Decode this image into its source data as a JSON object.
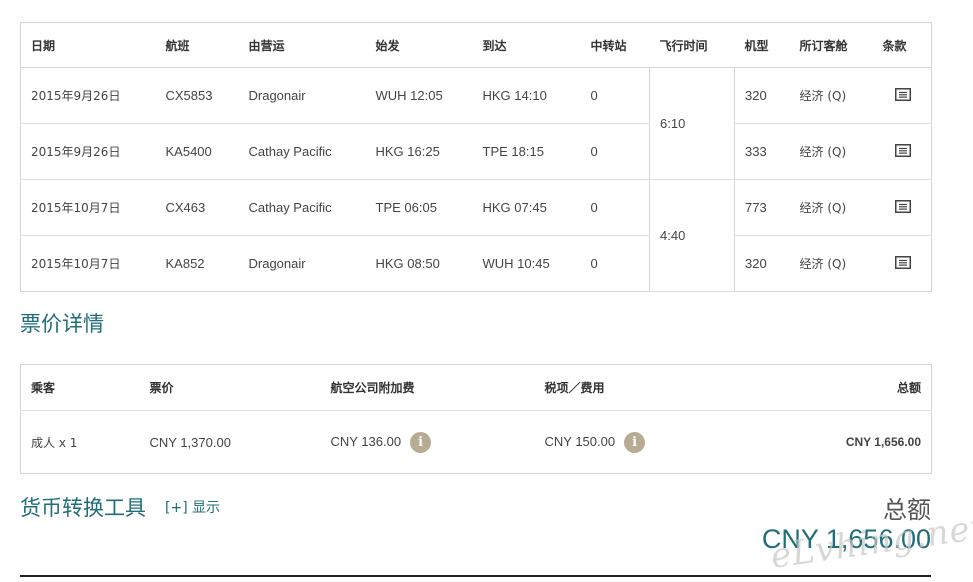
{
  "flights": {
    "headers": {
      "date": "日期",
      "flight": "航班",
      "operator": "由营运",
      "depart": "始发",
      "arrive": "到达",
      "stops": "中转站",
      "duration": "飞行时间",
      "aircraft": "机型",
      "cabin": "所订客舱",
      "terms": "条款"
    },
    "rows": [
      {
        "date": "2015年9月26日",
        "flight": "CX5853",
        "operator": "Dragonair",
        "depart": "WUH 12:05",
        "arrive": "HKG 14:10",
        "stops": "0",
        "aircraft": "320",
        "cabin": "经济 (Q)"
      },
      {
        "date": "2015年9月26日",
        "flight": "KA5400",
        "operator": "Cathay Pacific",
        "depart": "HKG 16:25",
        "arrive": "TPE 18:15",
        "stops": "0",
        "aircraft": "333",
        "cabin": "经济 (Q)"
      },
      {
        "date": "2015年10月7日",
        "flight": "CX463",
        "operator": "Cathay Pacific",
        "depart": "TPE 06:05",
        "arrive": "HKG 07:45",
        "stops": "0",
        "aircraft": "773",
        "cabin": "经济 (Q)"
      },
      {
        "date": "2015年10月7日",
        "flight": "KA852",
        "operator": "Dragonair",
        "depart": "HKG 08:50",
        "arrive": "WUH 10:45",
        "stops": "0",
        "aircraft": "320",
        "cabin": "经济 (Q)"
      }
    ],
    "durations": [
      "6:10",
      "4:40"
    ]
  },
  "fare_section": {
    "title": "票价详情",
    "headers": {
      "passenger": "乘客",
      "fare": "票价",
      "surcharge": "航空公司附加费",
      "taxes": "税项／费用",
      "total": "总额"
    },
    "row": {
      "passenger": "成人 x 1",
      "fare": "CNY 1,370.00",
      "surcharge": "CNY 136.00",
      "taxes": "CNY 150.00",
      "total": "CNY 1,656.00"
    },
    "info_icon_glyph": "i"
  },
  "currency_tool": {
    "title": "货币转换工具",
    "toggle_label": "[+] 显示"
  },
  "grand_total": {
    "label": "总额",
    "amount": "CNY 1,656.00"
  },
  "watermark": "eLvhing.net",
  "colors": {
    "accent": "#1f6e79",
    "link": "#1a6b7a",
    "info_icon": "#b8ab93",
    "border": "#d6d6d6"
  }
}
